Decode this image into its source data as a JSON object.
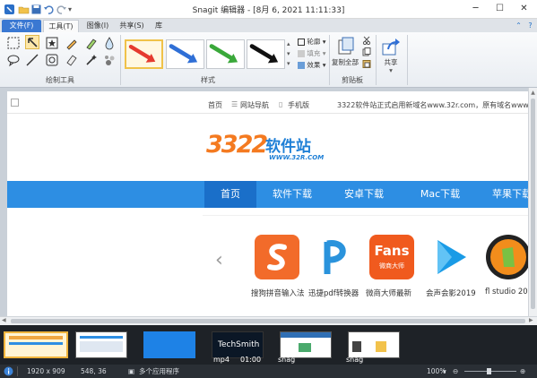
{
  "window": {
    "title": "Snagit 编辑器 - [8月 6, 2021 11:11:33]"
  },
  "tabs": [
    {
      "label": "文件(F)"
    },
    {
      "label": "工具(T)"
    },
    {
      "label": "图像(I)"
    },
    {
      "label": "共享(S)"
    },
    {
      "label": "库"
    }
  ],
  "ribbon": {
    "group_draw_tools": "绘制工具",
    "group_style": "样式",
    "outline_label": "轮廓",
    "fill_label": "填充",
    "effects_label": "效果",
    "copy_all_label": "复制全部",
    "clipboard_group": "剪贴板",
    "share_label": "共享",
    "style_colors": [
      "#e53b2f",
      "#2f6fd6",
      "#3aa83a",
      "#111111"
    ]
  },
  "webpage": {
    "top_links": [
      "首页",
      "网站导航",
      "手机版"
    ],
    "notice": "3322软件站正式启用新域名www.32r.com，原有域名www.3322",
    "logo_text": "3322",
    "logo_cn": "软件站",
    "logo_url": "WWW.32R.COM",
    "nav": [
      "首页",
      "软件下载",
      "安卓下载",
      "Mac下载",
      "苹果下载"
    ],
    "apps": [
      {
        "name": "搜狗拼音输入法",
        "color": "#f26b2a"
      },
      {
        "name": "迅捷pdf转换器",
        "color": "#ffffff"
      },
      {
        "name": "微商大师最新",
        "color": "#f05a1e"
      },
      {
        "name": "会声会影2019",
        "color": "#ffffff"
      },
      {
        "name": "fl studio 20",
        "color": "#222222"
      }
    ],
    "fans_text": "Fans",
    "fans_sub": "微商大师"
  },
  "tray": {
    "items": [
      {
        "label": ""
      },
      {
        "label": ""
      },
      {
        "label": ""
      },
      {
        "label": "mp4"
      },
      {
        "label": "snag"
      },
      {
        "label": "snag"
      }
    ],
    "time": "01:00",
    "techsmith": "TechSmith"
  },
  "status": {
    "size": "1920 x 909",
    "coords": "548, 36",
    "apps": "多个应用程序",
    "zoom": "100%"
  }
}
